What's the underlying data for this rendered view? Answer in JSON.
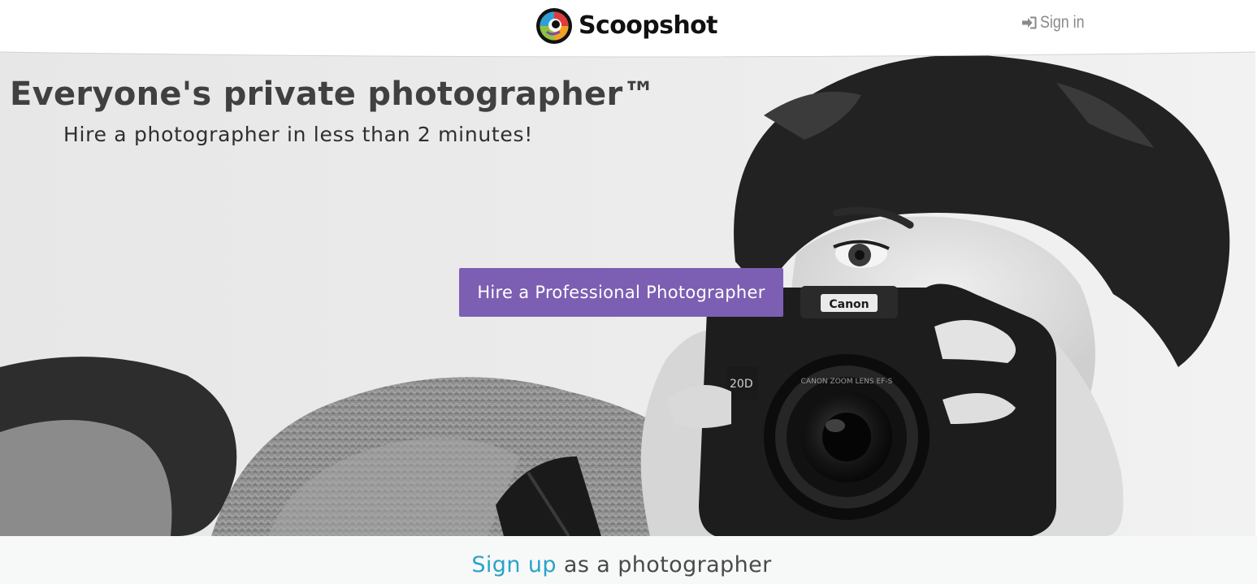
{
  "header": {
    "brand_name": "Scoopshot",
    "signin_label": "Sign in"
  },
  "hero": {
    "title": "Everyone's private photographer™",
    "subtitle": "Hire a photographer in less than 2 minutes!",
    "hire_button_label": "Hire a Professional Photographer",
    "photo_text": {
      "camera_brand": "Canon",
      "lens_marking": "CANON ZOOM LENS EF-S",
      "body_marking": "20D"
    }
  },
  "footer": {
    "signup_link_label": "Sign up",
    "signup_suffix": " as a photographer"
  },
  "colors": {
    "button_bg": "#7c5fb3",
    "link": "#29a3c9",
    "signin": "#888888",
    "title": "#404040"
  },
  "icons": {
    "brand": "scoopshot-logo-icon",
    "signin": "sign-in-icon"
  }
}
